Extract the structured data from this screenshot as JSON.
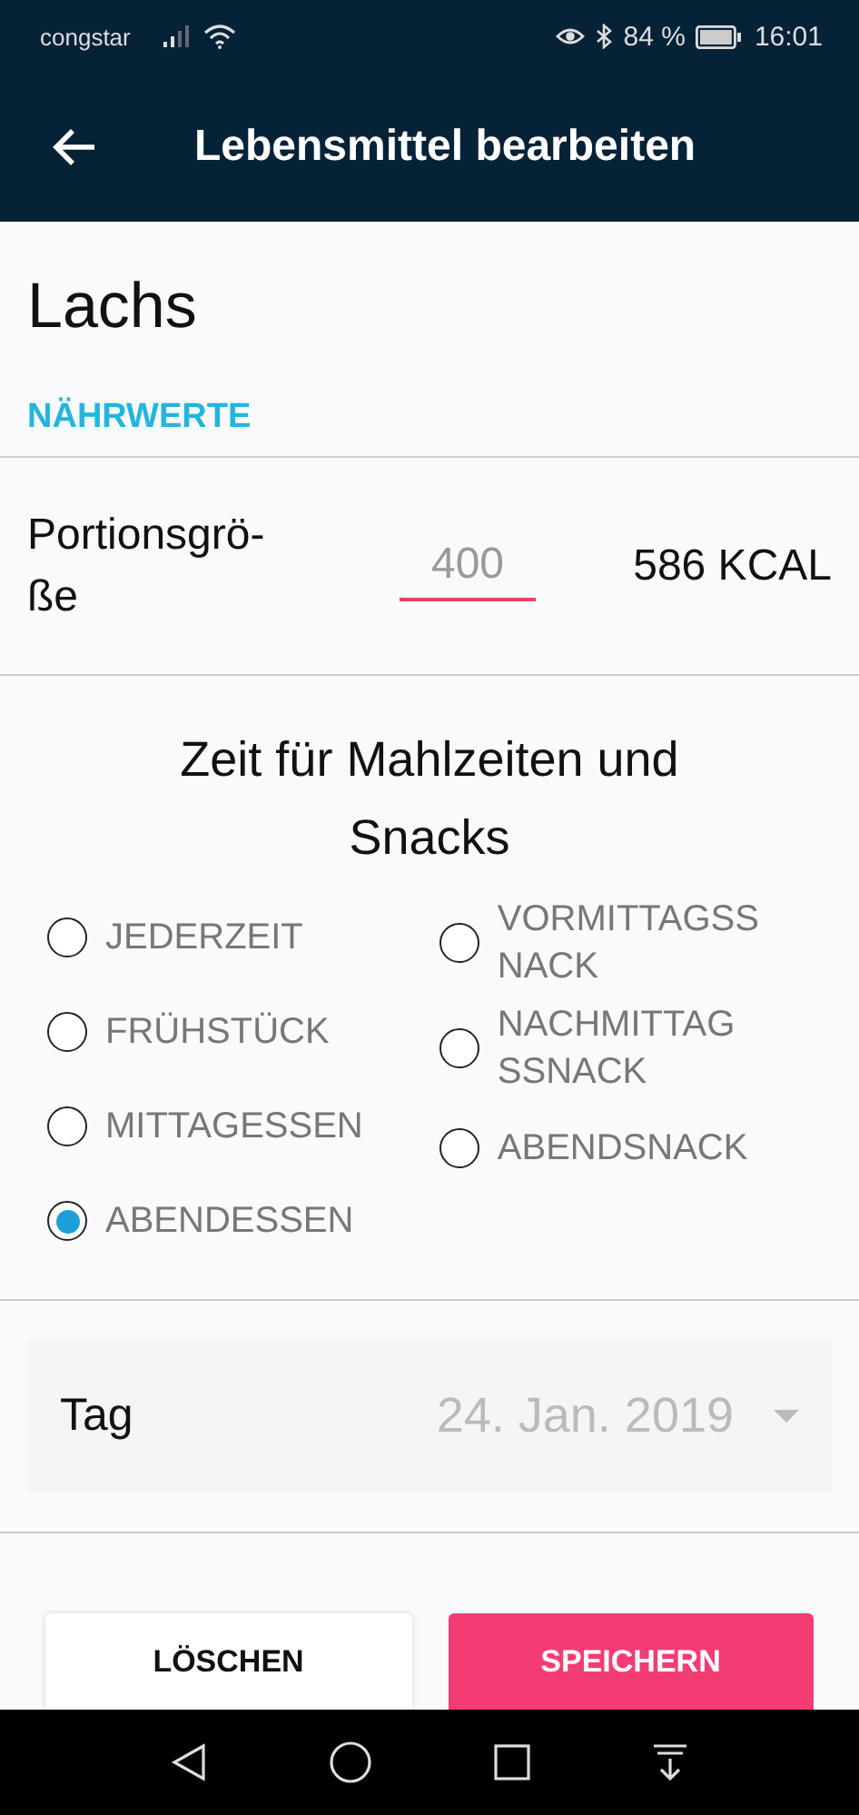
{
  "status_bar": {
    "carrier": "congstar",
    "battery": "84 %",
    "time": "16:01"
  },
  "app_bar": {
    "title": "Lebensmittel bearbeiten"
  },
  "food": {
    "name": "Lachs"
  },
  "section": "NÄHRWERTE",
  "portion": {
    "label": "Portionsgrö-\nße",
    "value": "400",
    "calories": "586 KCAL"
  },
  "meal_time": {
    "heading": "Zeit für Mahlzeiten und Snacks",
    "options": [
      {
        "label": "JEDERZEIT",
        "selected": false
      },
      {
        "label": "VORMITTAGSS\nNACK",
        "selected": false
      },
      {
        "label": "FRÜHSTÜCK",
        "selected": false
      },
      {
        "label": "NACHMITTAG\nSSNACK",
        "selected": false
      },
      {
        "label": "MITTAGESSEN",
        "selected": false
      },
      {
        "label": "ABENDSNACK",
        "selected": false
      },
      {
        "label": "ABENDESSEN",
        "selected": true
      }
    ]
  },
  "day": {
    "label": "Tag",
    "value": "24. Jan. 2019"
  },
  "buttons": [
    {
      "label": "LÖSCHEN",
      "kind": "secondary"
    },
    {
      "label": "SPEICHERN",
      "kind": "primary"
    }
  ]
}
